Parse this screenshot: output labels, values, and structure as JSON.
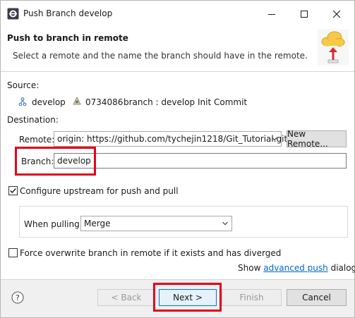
{
  "window": {
    "title": "Push Branch develop"
  },
  "banner": {
    "title": "Push to branch in remote",
    "description": "Select a remote and the name the branch should have in the remote."
  },
  "source": {
    "label": "Source:",
    "branch": "develop",
    "commit_id": "0734086",
    "commit_desc": "branch : develop Init Commit"
  },
  "destination": {
    "label": "Destination:",
    "remote_label": "Remote:",
    "remote_value": "origin: https://github.com/tychejin1218/Git_Tutorial.git",
    "new_remote_label": "New Remote...",
    "branch_label": "Branch:",
    "branch_value": "develop"
  },
  "upstream": {
    "label": "Configure upstream for push and pull",
    "checked": true,
    "when_pulling_label": "When pulling:",
    "when_pulling_value": "Merge"
  },
  "force": {
    "label": "Force overwrite branch in remote if it exists and has diverged",
    "checked": false
  },
  "advanced": {
    "prefix": "Show",
    "link": "advanced push",
    "suffix": "dialog"
  },
  "buttons": {
    "back": "< Back",
    "next": "Next >",
    "finish": "Finish",
    "cancel": "Cancel"
  },
  "icons": {
    "app": "eclipse-icon",
    "banner": "cloud-upload-icon",
    "help": "help-icon"
  },
  "colors": {
    "highlight": "#e3001b",
    "link": "#0066cc",
    "default_button_border": "#0078d7"
  }
}
